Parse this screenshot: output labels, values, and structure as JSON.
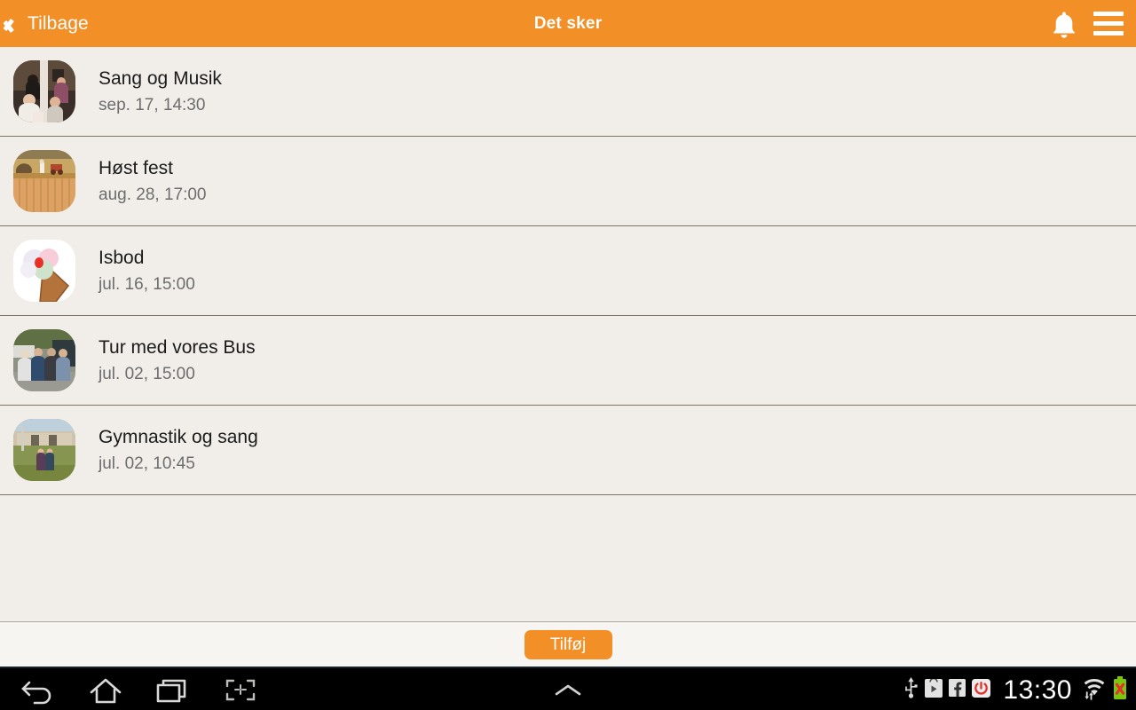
{
  "header": {
    "back_label": "Tilbage",
    "back_icon": "chevron-left-icon",
    "title": "Det sker",
    "notifications_icon": "bell-icon",
    "menu_icon": "hamburger-menu-icon",
    "background_color": "#f28f26",
    "text_color": "#ffffff"
  },
  "list": {
    "items": [
      {
        "title": "Sang og Musik",
        "date": "sep. 17, 14:30",
        "thumbnail": "photo-indoor-singing-group"
      },
      {
        "title": "Høst fest",
        "date": "aug. 28, 17:00",
        "thumbnail": "photo-harvest-field-wagon"
      },
      {
        "title": "Isbod",
        "date": "jul. 16, 15:00",
        "thumbnail": "photo-ice-cream-cone"
      },
      {
        "title": "Tur med vores Bus",
        "date": "jul. 02, 15:00",
        "thumbnail": "photo-people-by-bus"
      },
      {
        "title": "Gymnastik og sang",
        "date": "jul. 02, 10:45",
        "thumbnail": "photo-two-people-outdoors"
      }
    ]
  },
  "footer": {
    "add_label": "Tilføj",
    "add_color": "#f28f26"
  },
  "navbar": {
    "back_icon": "back-arrow-icon",
    "home_icon": "home-icon",
    "recents_icon": "recent-apps-icon",
    "screenshot_icon": "screenshot-capture-icon",
    "expand_icon": "chevron-up-icon",
    "status_icons": [
      "usb-icon",
      "play-store-icon",
      "facebook-icon",
      "red-circle-app-icon"
    ],
    "clock": "13:30",
    "wifi_icon": "wifi-data-icon",
    "battery_icon": "battery-error-icon"
  },
  "colors": {
    "accent": "#f28f26",
    "page_background": "#f1eeea",
    "row_divider": "#7d7468",
    "title_text": "#1b1b1b",
    "date_text": "#6d6d6d"
  }
}
